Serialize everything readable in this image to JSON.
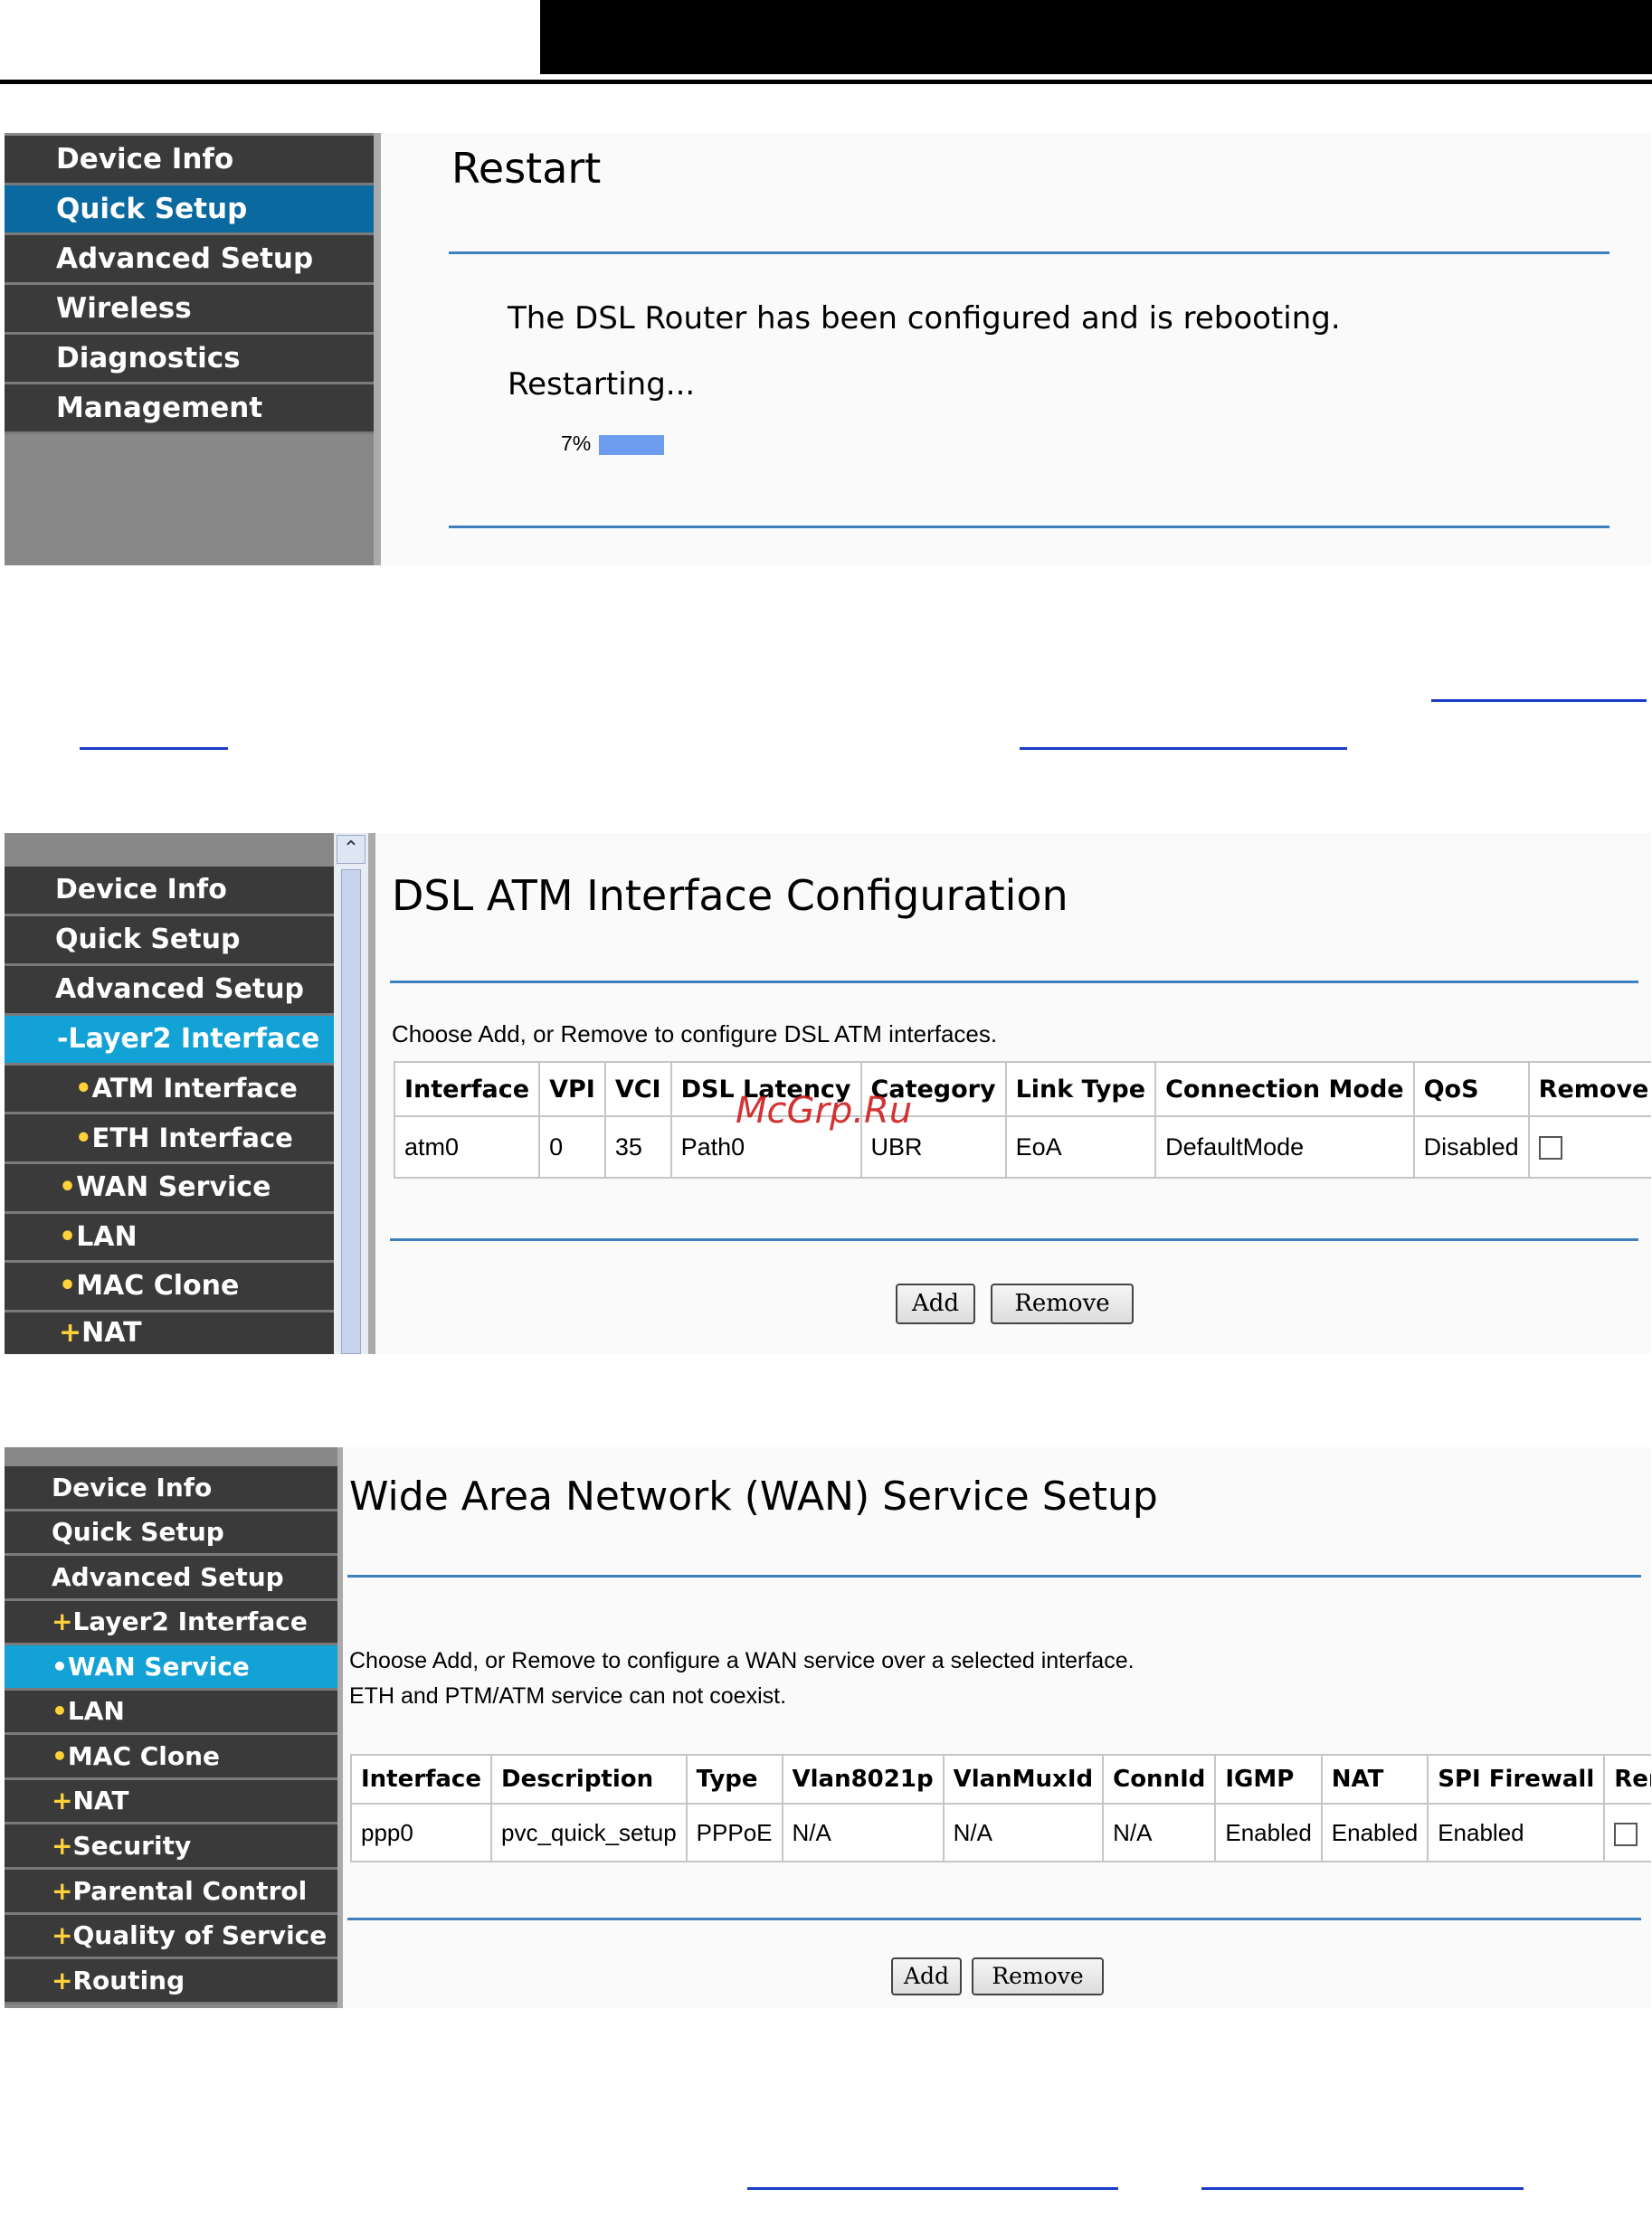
{
  "panel1": {
    "nav": [
      "Device Info",
      "Quick Setup",
      "Advanced Setup",
      "Wireless",
      "Diagnostics",
      "Management"
    ],
    "active_index": 1,
    "title": "Restart",
    "message": "The DSL Router has been configured and is rebooting.",
    "status": "Restarting...",
    "progress_label": "7%",
    "progress_fraction": 0.07,
    "progress_color": "#6e9df0"
  },
  "panel2": {
    "nav": [
      {
        "bullet": "",
        "label": "Device Info"
      },
      {
        "bullet": "",
        "label": "Quick Setup"
      },
      {
        "bullet": "",
        "label": "Advanced Setup"
      },
      {
        "bullet": "-",
        "label": "Layer2 Interface"
      },
      {
        "bullet": "•",
        "label": "ATM Interface"
      },
      {
        "bullet": "•",
        "label": "ETH Interface"
      },
      {
        "bullet": "•",
        "label": "WAN Service"
      },
      {
        "bullet": "•",
        "label": "LAN"
      },
      {
        "bullet": "•",
        "label": "MAC Clone"
      },
      {
        "bullet": "+",
        "label": "NAT"
      }
    ],
    "title": "DSL ATM Interface Configuration",
    "instruction": "Choose Add, or Remove to configure DSL ATM interfaces.",
    "table": {
      "headers": [
        "Interface",
        "VPI",
        "VCI",
        "DSL Latency",
        "Category",
        "Link Type",
        "Connection Mode",
        "QoS",
        "Remove"
      ],
      "rows": [
        [
          "atm0",
          "0",
          "35",
          "Path0",
          "UBR",
          "EoA",
          "DefaultMode",
          "Disabled",
          ""
        ]
      ]
    },
    "add_label": "Add",
    "remove_label": "Remove",
    "watermark": "McGrp.Ru"
  },
  "panel3": {
    "nav": [
      {
        "bullet": "",
        "label": "Device Info"
      },
      {
        "bullet": "",
        "label": "Quick Setup"
      },
      {
        "bullet": "",
        "label": "Advanced Setup"
      },
      {
        "bullet": "+",
        "label": "Layer2 Interface"
      },
      {
        "bullet": "•",
        "label": "WAN Service"
      },
      {
        "bullet": "•",
        "label": "LAN"
      },
      {
        "bullet": "•",
        "label": "MAC Clone"
      },
      {
        "bullet": "+",
        "label": "NAT"
      },
      {
        "bullet": "+",
        "label": "Security"
      },
      {
        "bullet": "+",
        "label": "Parental Control"
      },
      {
        "bullet": "+",
        "label": "Quality of Service"
      },
      {
        "bullet": "+",
        "label": "Routing"
      }
    ],
    "title": "Wide Area Network (WAN) Service Setup",
    "instruction1": "Choose Add, or Remove to configure a WAN service over a selected interface.",
    "instruction2": "ETH and PTM/ATM service can not coexist.",
    "table": {
      "headers": [
        "Interface",
        "Description",
        "Type",
        "Vlan8021p",
        "VlanMuxId",
        "ConnId",
        "IGMP",
        "NAT",
        "SPI Firewall",
        "Remove"
      ],
      "rows": [
        [
          "ppp0",
          "pvc_quick_setup",
          "PPPoE",
          "N/A",
          "N/A",
          "N/A",
          "Enabled",
          "Enabled",
          "Enabled",
          ""
        ]
      ]
    },
    "add_label": "Add",
    "remove_label": "Remove"
  }
}
